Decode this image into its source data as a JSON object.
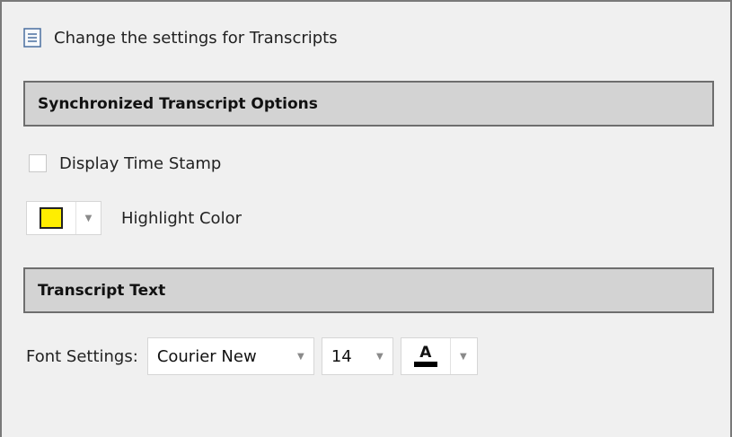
{
  "header": {
    "icon": "document-icon",
    "title": "Change the settings for Transcripts"
  },
  "sync_section": {
    "title": "Synchronized Transcript Options",
    "display_time_stamp": {
      "label": "Display Time Stamp",
      "checked": false
    },
    "highlight_color": {
      "label": "Highlight Color",
      "value": "#ffee00"
    }
  },
  "text_section": {
    "title": "Transcript Text",
    "font_settings": {
      "label": "Font Settings:",
      "font_family": "Courier New",
      "font_size": "14",
      "font_color_letter": "A",
      "font_color": "#000000"
    }
  },
  "colors": {
    "section_bar_bg": "#d3d3d3",
    "section_bar_border": "#6e6e6e",
    "window_bg": "#f0f0f0"
  }
}
